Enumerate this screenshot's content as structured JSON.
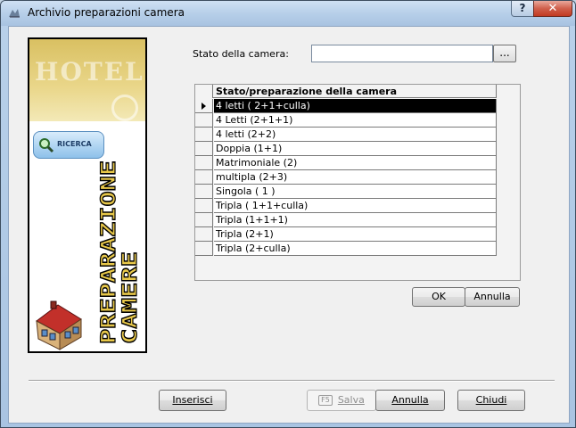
{
  "window": {
    "title": "Archivio preparazioni camera",
    "help_label": "?",
    "close_label": "✕"
  },
  "sidebar": {
    "hotel_text": "HOTEL",
    "ricerca_label": "RICERCA",
    "vertical_text_col1": "PREPARAZIONE",
    "vertical_text_col2": "CAMERE"
  },
  "form": {
    "stato_label": "Stato della camera:",
    "stato_value": "",
    "browse_label": "..."
  },
  "grid": {
    "header": "Stato/preparazione della camera",
    "rows": [
      "4 letti ( 2+1+culla)",
      "4 Letti (2+1+1)",
      "4 letti (2+2)",
      "Doppia (1+1)",
      "Matrimoniale (2)",
      "multipla (2+3)",
      "Singola ( 1 )",
      "Tripla ( 1+1+culla)",
      "Tripla (1+1+1)",
      "Tripla (2+1)",
      "Tripla (2+culla)"
    ],
    "selected_index": 0
  },
  "buttons": {
    "ok": "OK",
    "annulla_top": "Annulla",
    "inserisci": "Inserisci",
    "salva_key": "F5",
    "salva": "Salva",
    "annulla_bottom": "Annulla",
    "chiudi": "Chiudi"
  }
}
